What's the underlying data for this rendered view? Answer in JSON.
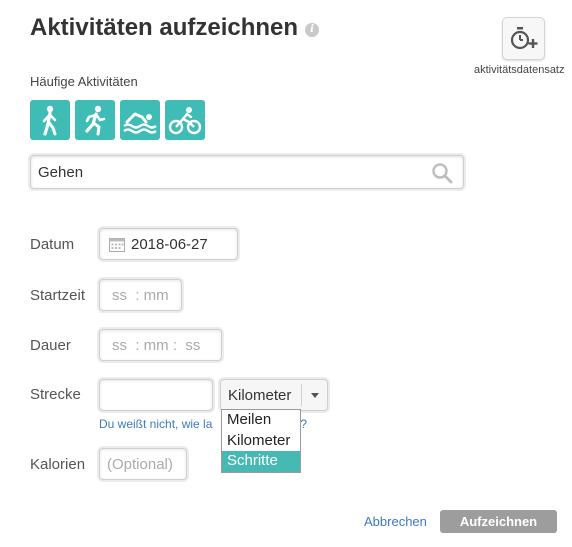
{
  "header": {
    "title": "Aktivitäten aufzeichnen",
    "info_icon": "info-icon",
    "dataset_button_label": "aktivitätsdatensatz",
    "dataset_icon": "stopwatch-plus-icon"
  },
  "frequent": {
    "label": "Häufige Aktivitäten",
    "activities": [
      "walking-icon",
      "running-icon",
      "swimming-icon",
      "cycling-icon"
    ],
    "accent_color": "#3fbcb5"
  },
  "search": {
    "value": "Gehen",
    "icon": "search-icon"
  },
  "form": {
    "date_label": "Datum",
    "date_value": "2018-06-27",
    "start_label": "Startzeit",
    "start_placeholder": "ss  : mm",
    "duration_label": "Dauer",
    "duration_placeholder": "ss  : mm :  ss",
    "distance_label": "Strecke",
    "distance_unit_selected": "Kilometer",
    "distance_unit_options": [
      "Meilen",
      "Kilometer",
      "Schritte"
    ],
    "distance_unit_highlighted": "Schritte",
    "help_link_text": "Du weißt nicht, wie la",
    "help_link_text_tail": "e ist?",
    "calories_label": "Kalorien",
    "calories_placeholder": "(Optional)"
  },
  "footer": {
    "cancel_label": "Abbrechen",
    "submit_label": "Aufzeichnen"
  }
}
